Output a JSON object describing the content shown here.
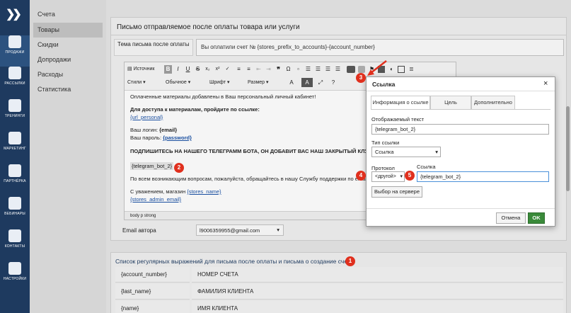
{
  "nav": {
    "items": [
      {
        "label": "ПРОДАЖИ",
        "icon": "cart-icon"
      },
      {
        "label": "РАССЫЛКИ",
        "icon": "megaphone-icon"
      },
      {
        "label": "ТРЕНИНГИ",
        "icon": "graduation-cap-icon"
      },
      {
        "label": "МАРКЕТИНГ",
        "icon": "bar-chart-icon"
      },
      {
        "label": "ПАРТНЁРКА",
        "icon": "network-icon"
      },
      {
        "label": "ВЕБИНАРЫ",
        "icon": "play-icon"
      },
      {
        "label": "КОНТАКТЫ",
        "icon": "people-icon"
      },
      {
        "label": "НАСТРОЙКИ",
        "icon": "gear-icon"
      }
    ]
  },
  "submenu": {
    "items": [
      "Счета",
      "Товары",
      "Скидки",
      "Допродажи",
      "Расходы",
      "Статистика"
    ],
    "selected": "Товары"
  },
  "form": {
    "section_title": "Письмо отправляемое после оплаты товара или услуги",
    "subject_label": "Тема письма после оплаты",
    "subject_value": "Вы оплатили счет № {stores_prefix_to_accounts}-{account_number}",
    "email_author_label": "Email автора",
    "email_author_value": "l9006359955@gmail.com"
  },
  "editor": {
    "source_btn": "Источник",
    "styles": "Стили",
    "format": "Обычное",
    "font": "Шрифт",
    "size": "Размер",
    "path": [
      "body",
      "p",
      "strong"
    ],
    "lines": {
      "l1": "Оплаченные материалы добавлены в Ваш персональный личный кабинет!",
      "l2": "Для доступа к материалам, пройдите по ссылке:",
      "l3": "{url_personal}",
      "l4a": "Ваш логин: ",
      "l4b": "{email}",
      "l5a": "Ваш пароль: ",
      "l5b": "{password}",
      "l6": "ПОДПИШИТЕСЬ НА НАШЕГО ТЕЛЕГРАММ БОТА, ОН ДОБАВИТ ВАС НАШ ЗАКРЫТЫЙ КЛУБ",
      "l7": "{telegram_bot_2}",
      "l8": "По всем возникающим вопросам, пожалуйста, обращайтесь в нашу Службу поддержки по email:",
      "l9a": "С уважением, магазин ",
      "l9b": "{stores_name}",
      "l10": "{stores_admin_email}"
    }
  },
  "regex": {
    "title": "Список регулярных выражений для письма после оплаты и письма о создание счета",
    "rows": [
      {
        "key": "{account_number}",
        "desc": "НОМЕР СЧЕТА"
      },
      {
        "key": "{last_name}",
        "desc": "ФАМИЛИЯ КЛИЕНТА"
      },
      {
        "key": "{name}",
        "desc": "ИМЯ КЛИЕНТА"
      }
    ]
  },
  "dialog": {
    "title": "Ссылка",
    "tabs": [
      "Информация о ссылке",
      "Цель",
      "Дополнительно"
    ],
    "display_text_label": "Отображаемый текст",
    "display_text_value": "{telegram_bot_2}",
    "link_type_label": "Тип ссылки",
    "link_type_value": "Ссылка",
    "protocol_label": "Протокол",
    "protocol_value": "<другой>",
    "url_label": "Ссылка",
    "url_value": "{telegram_bot_2}",
    "browse_server": "Выбор на сервере",
    "cancel": "Отмена",
    "ok": "OK"
  },
  "badges": [
    "1",
    "2",
    "3",
    "4",
    "5"
  ],
  "colors": {
    "nav_bg": "#1e3a5f",
    "badge": "#e0301e",
    "ok": "#3a8a3a",
    "link": "#1a4fa0"
  }
}
